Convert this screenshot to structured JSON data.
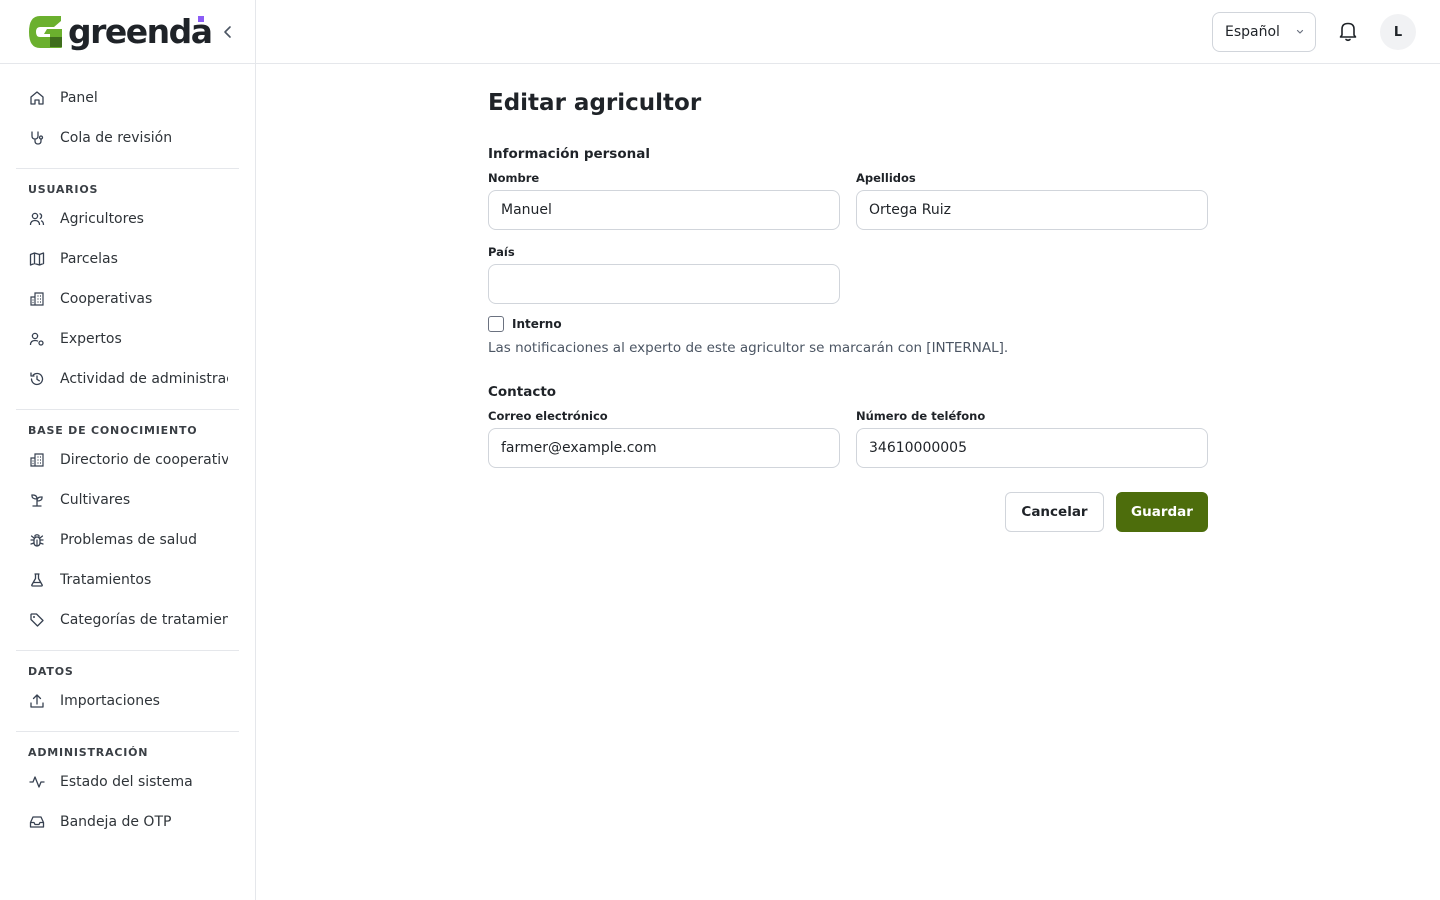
{
  "brand": {
    "name": "greenda",
    "accent": "#4d6d0c",
    "dot_color": "#8b5cf6",
    "logo_green": "#6bb02e"
  },
  "sidebar": {
    "collapse_icon": "chevron-left-icon",
    "top_items": [
      {
        "label": "Panel",
        "icon": "home-icon"
      },
      {
        "label": "Cola de revisión",
        "icon": "stethoscope-icon"
      }
    ],
    "sections": [
      {
        "title": "USUARIOS",
        "items": [
          {
            "label": "Agricultores",
            "icon": "users-icon"
          },
          {
            "label": "Parcelas",
            "icon": "map-icon"
          },
          {
            "label": "Cooperativas",
            "icon": "building-icon"
          },
          {
            "label": "Expertos",
            "icon": "user-cog-icon"
          },
          {
            "label": "Actividad de administración",
            "icon": "history-icon"
          }
        ]
      },
      {
        "title": "BASE DE CONOCIMIENTO",
        "items": [
          {
            "label": "Directorio de cooperativas",
            "icon": "building-icon"
          },
          {
            "label": "Cultivares",
            "icon": "sprout-icon"
          },
          {
            "label": "Problemas de salud",
            "icon": "bug-icon"
          },
          {
            "label": "Tratamientos",
            "icon": "flask-icon"
          },
          {
            "label": "Categorías de tratamientos",
            "icon": "tag-icon"
          }
        ]
      },
      {
        "title": "DATOS",
        "items": [
          {
            "label": "Importaciones",
            "icon": "upload-icon"
          }
        ]
      },
      {
        "title": "ADMINISTRACIÓN",
        "items": [
          {
            "label": "Estado del sistema",
            "icon": "activity-icon"
          },
          {
            "label": "Bandeja de OTP",
            "icon": "inbox-icon"
          }
        ]
      }
    ]
  },
  "header": {
    "language": "Español",
    "bell_icon": "bell-icon",
    "avatar_initial": "L"
  },
  "form": {
    "title": "Editar agricultor",
    "personal_section": "Información personal",
    "first_name_label": "Nombre",
    "first_name_value": "Manuel",
    "last_name_label": "Apellidos",
    "last_name_value": "Ortega Ruiz",
    "country_label": "País",
    "country_value": "",
    "internal_label": "Interno",
    "internal_checked": false,
    "internal_hint": "Las notificaciones al experto de este agricultor se marcarán con [INTERNAL].",
    "contact_section": "Contacto",
    "email_label": "Correo electrónico",
    "email_value": "farmer@example.com",
    "phone_label": "Número de teléfono",
    "phone_value": "34610000005",
    "cancel_label": "Cancelar",
    "save_label": "Guardar"
  }
}
